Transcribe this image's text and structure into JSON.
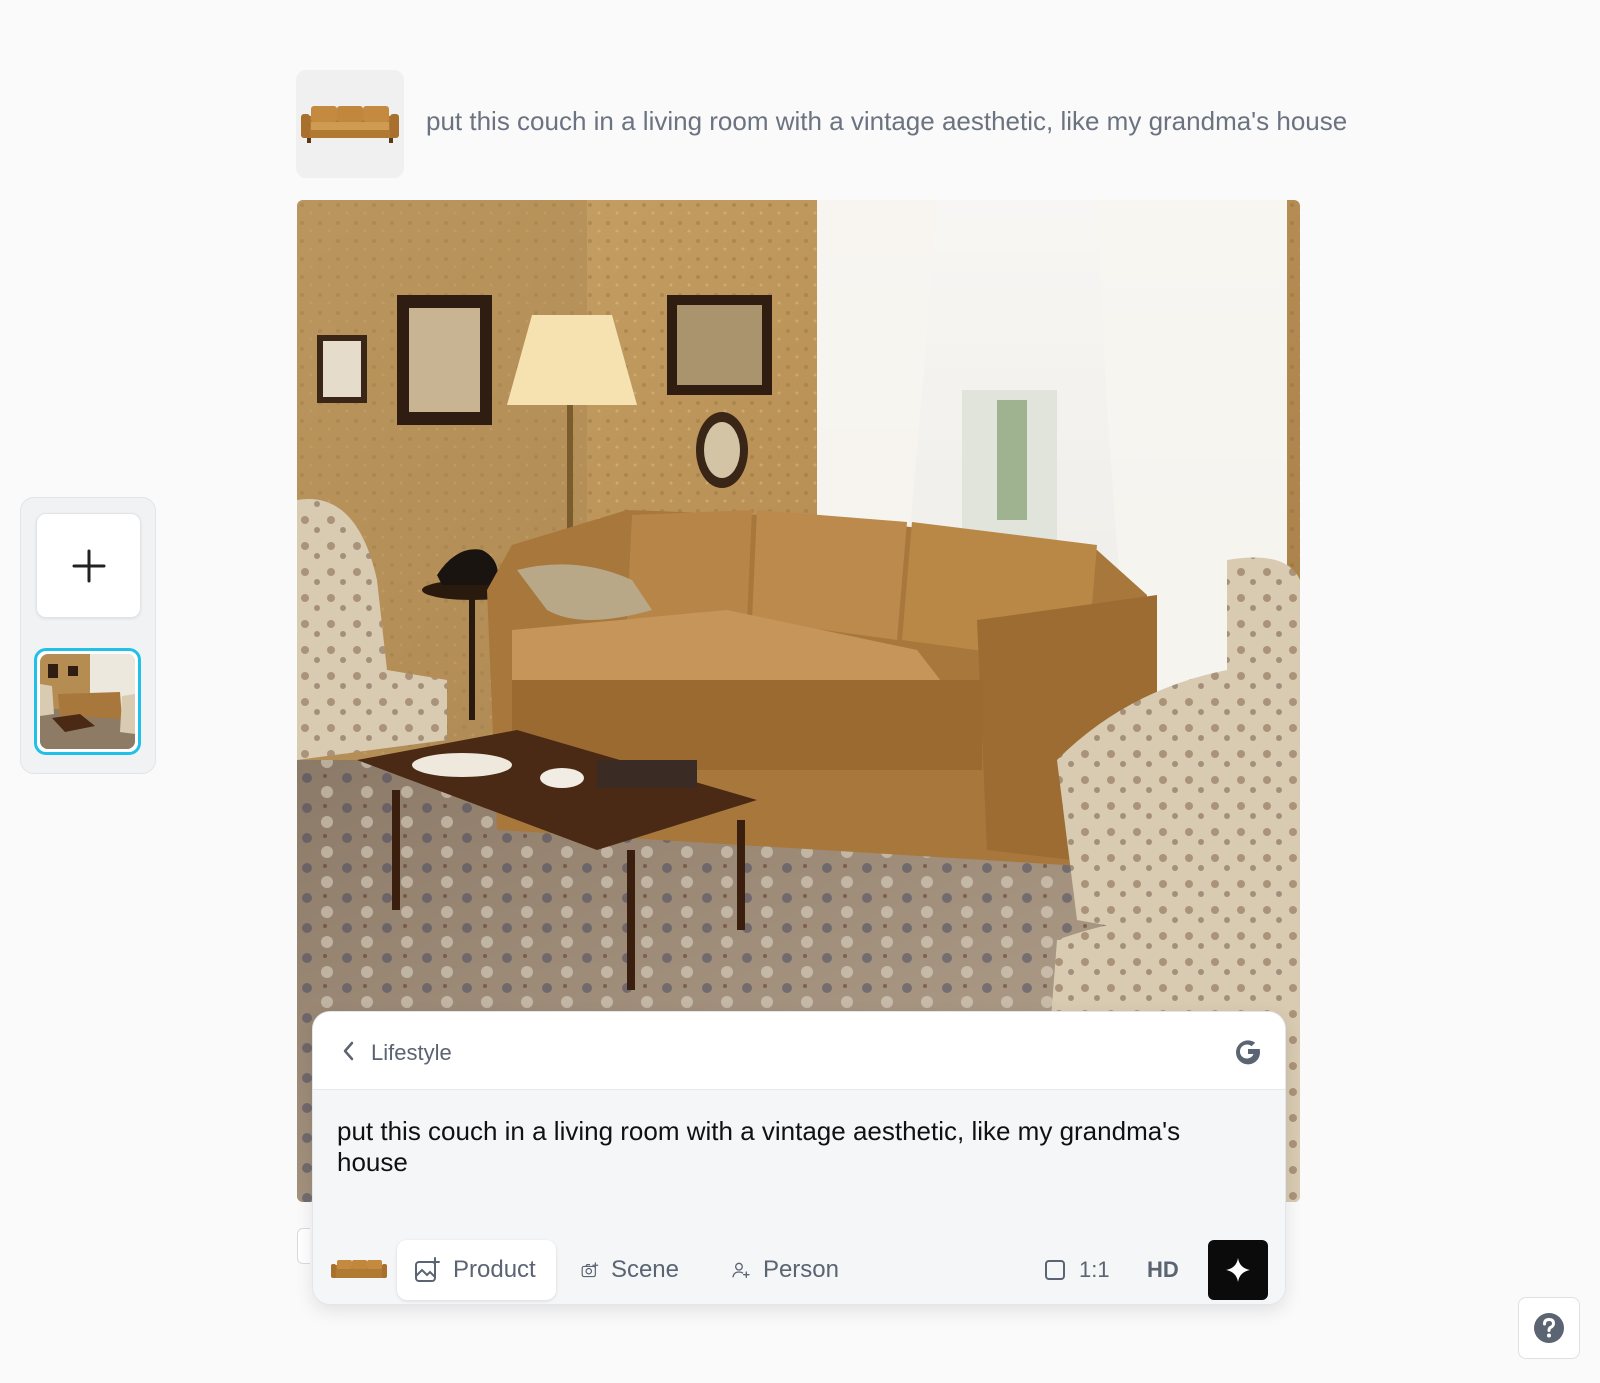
{
  "conversation": {
    "user_prompt": "put this couch in a living room with a vintage aesthetic, like my grandma's house",
    "attachment_icon": "couch-thumbnail"
  },
  "rail": {
    "add_icon": "plus-icon",
    "selected_thumb": "generated-living-room-thumbnail"
  },
  "composer": {
    "mode_label": "Lifestyle",
    "back_icon": "chevron-left-icon",
    "brand_icon": "google-g-icon",
    "prompt_value": "put this couch in a living room with a vintage aesthetic, like my grandma's house",
    "tools": [
      {
        "label": "Product",
        "icon": "image-plus-icon",
        "active": true
      },
      {
        "label": "Scene",
        "icon": "camera-plus-icon",
        "active": false
      },
      {
        "label": "Person",
        "icon": "person-plus-icon",
        "active": false
      }
    ],
    "aspect_ratio": "1:1",
    "quality": "HD",
    "generate_icon": "sparkle-icon"
  },
  "help_icon": "question-icon",
  "colors": {
    "accent_selection": "#22c0e8",
    "generate_button": "#0b0b0c",
    "muted_text": "#6b7280"
  }
}
